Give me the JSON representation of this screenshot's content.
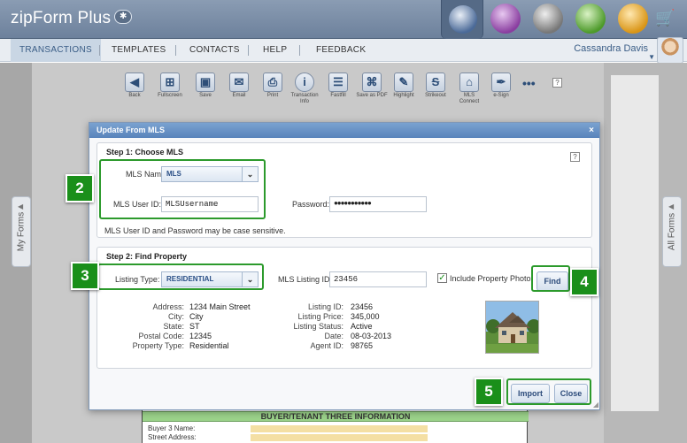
{
  "app": {
    "name": "zipForm Plus"
  },
  "nav": {
    "items": [
      "TRANSACTIONS",
      "TEMPLATES",
      "CONTACTS",
      "HELP",
      "FEEDBACK"
    ],
    "user": "Cassandra Davis"
  },
  "side_tabs": {
    "left": "My Forms",
    "right": "All Forms"
  },
  "toolbar": {
    "back": "Back",
    "fullscreen": "Fullscreen",
    "save": "Save",
    "email": "Email",
    "print": "Print",
    "transaction_info": "Transaction Info",
    "fastfill": "Fastfill",
    "save_as_pdf": "Save as PDF",
    "highlight": "Highlight",
    "strikeout": "Strikeout",
    "mls_connect": "MLS Connect",
    "esign": "e-Sign",
    "more": "•••",
    "help": "?"
  },
  "modal": {
    "title": "Update From MLS",
    "close": "×",
    "help": "?",
    "step1": {
      "title": "Step 1: Choose MLS",
      "mls_name_label": "MLS Name:",
      "mls_name_value": "MLS",
      "user_id_label": "MLS User ID:",
      "user_id_value": "MLSUsername",
      "password_label": "Password:",
      "password_value": "●●●●●●●●●●●",
      "note": "MLS User ID and Password may be case sensitive."
    },
    "step2": {
      "title": "Step 2: Find Property",
      "listing_type_label": "Listing Type:",
      "listing_type_value": "RESIDENTIAL",
      "listing_id_label": "MLS Listing ID:",
      "listing_id_value": "23456",
      "include_photo_label": "Include Property Photo",
      "include_photo_checked": true,
      "find_button": "Find"
    },
    "property": {
      "address_label": "Address:",
      "address": "1234 Main Street",
      "city_label": "City:",
      "city": "City",
      "state_label": "State:",
      "state": "ST",
      "postal_label": "Postal Code:",
      "postal": "12345",
      "type_label": "Property Type:",
      "type": "Residential",
      "listing_id_label": "Listing ID:",
      "listing_id": "23456",
      "price_label": "Listing Price:",
      "price": "345,000",
      "status_label": "Listing Status:",
      "status": "Active",
      "date_label": "Date:",
      "date": "08-03-2013",
      "agent_label": "Agent ID:",
      "agent": "98765"
    },
    "buttons": {
      "import": "Import",
      "close": "Close"
    }
  },
  "annotations": [
    "2",
    "3",
    "4",
    "5"
  ],
  "document": {
    "section": "BUYER/TENANT THREE INFORMATION",
    "buyer_name": "Buyer 3 Name:",
    "street_address": "Street Address:"
  },
  "colors": {
    "accent": "#2c9a2c",
    "header": "#6d819c",
    "modal_title": "#5883bb"
  }
}
